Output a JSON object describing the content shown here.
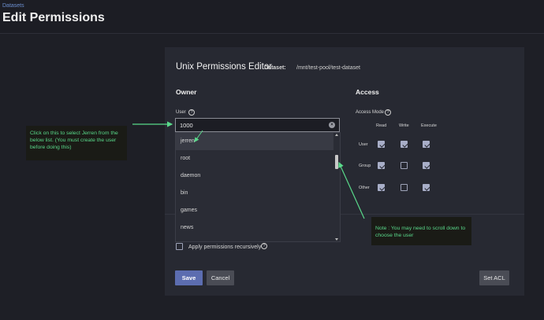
{
  "header": {
    "breadcrumb": "Datasets",
    "title": "Edit Permissions"
  },
  "editor": {
    "title": "Unix Permissions Editor",
    "dataset_label": "Dataset:",
    "dataset_value": "/mnt/test-pool/test-dataset"
  },
  "owner": {
    "section_title": "Owner",
    "user_label": "User",
    "user_value": "1000",
    "clear_icon": "close-circle-icon",
    "dropdown_options": [
      "jerren",
      "root",
      "daemon",
      "bin",
      "games",
      "news"
    ],
    "highlighted_option": "jerren"
  },
  "access": {
    "section_title": "Access",
    "mode_label": "Access Mode",
    "columns": [
      "Read",
      "Write",
      "Execute"
    ],
    "rows": [
      {
        "label": "User",
        "read": true,
        "write": true,
        "execute": true
      },
      {
        "label": "Group",
        "read": true,
        "write": false,
        "execute": true
      },
      {
        "label": "Other",
        "read": true,
        "write": false,
        "execute": true
      }
    ]
  },
  "recursive": {
    "label": "Apply permissions recursively",
    "checked": false
  },
  "buttons": {
    "save": "Save",
    "cancel": "Cancel",
    "set_acl": "Set ACL"
  },
  "annotations": {
    "left_note": "Click on this to select Jerren from the below list. (You must create the user before doing this)",
    "right_note": "Note : You may need to scroll down to choose the user",
    "arrow_color": "#59d98a"
  },
  "colors": {
    "accent": "#5c6db0",
    "background": "#1e1f26",
    "card": "#272932"
  }
}
